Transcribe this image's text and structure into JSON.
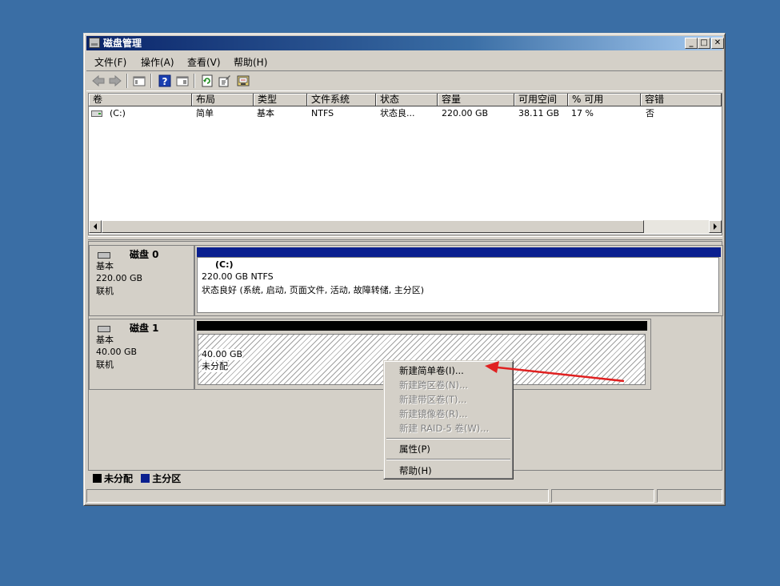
{
  "window": {
    "title": "磁盘管理",
    "controls": {
      "minimize": "_",
      "maximize": "□",
      "close": "✕"
    }
  },
  "menubar": [
    {
      "label": "文件(F)"
    },
    {
      "label": "操作(A)"
    },
    {
      "label": "查看(V)"
    },
    {
      "label": "帮助(H)"
    }
  ],
  "toolbar": {
    "icons": [
      "back-arrow-icon",
      "forward-arrow-icon",
      "show-hide-console-tree-icon",
      "help-icon",
      "properties-pane-icon",
      "refresh-icon",
      "properties-icon",
      "rescan-disks-icon"
    ]
  },
  "volume_list": {
    "columns": [
      "卷",
      "布局",
      "类型",
      "文件系统",
      "状态",
      "容量",
      "可用空间",
      "% 可用",
      "容错"
    ],
    "rows": [
      {
        "volume": "(C:)",
        "layout": "简单",
        "type": "基本",
        "fs": "NTFS",
        "status": "状态良...",
        "capacity": "220.00 GB",
        "free": "38.11 GB",
        "pct_free": "17 %",
        "fault_tolerance": "否"
      }
    ]
  },
  "disks": [
    {
      "name": "磁盘 0",
      "kind": "基本",
      "size": "220.00 GB",
      "state": "联机",
      "volume": {
        "label": "(C:)",
        "size_fs": "220.00 GB NTFS",
        "status": "状态良好 (系统, 启动, 页面文件, 活动, 故障转储, 主分区)"
      }
    },
    {
      "name": "磁盘 1",
      "kind": "基本",
      "size": "40.00 GB",
      "state": "联机",
      "volume": {
        "size": "40.00 GB",
        "status": "未分配"
      }
    }
  ],
  "legend": [
    {
      "label": "未分配",
      "color": "#000000"
    },
    {
      "label": "主分区",
      "color": "#0a1f8f"
    }
  ],
  "context_menu": {
    "items": [
      {
        "label": "新建简单卷(I)...",
        "enabled": true
      },
      {
        "label": "新建跨区卷(N)...",
        "enabled": false
      },
      {
        "label": "新建带区卷(T)...",
        "enabled": false
      },
      {
        "label": "新建镜像卷(R)...",
        "enabled": false
      },
      {
        "label": "新建 RAID-5 卷(W)...",
        "enabled": false
      },
      {
        "label": "属性(P)",
        "enabled": true
      },
      {
        "label": "帮助(H)",
        "enabled": true
      }
    ]
  },
  "colors": {
    "desktop": "#3a6ea5",
    "primary_partition_bar": "#0a1f8f",
    "unallocated_bar": "#000000",
    "annotation_arrow": "#e02020"
  }
}
